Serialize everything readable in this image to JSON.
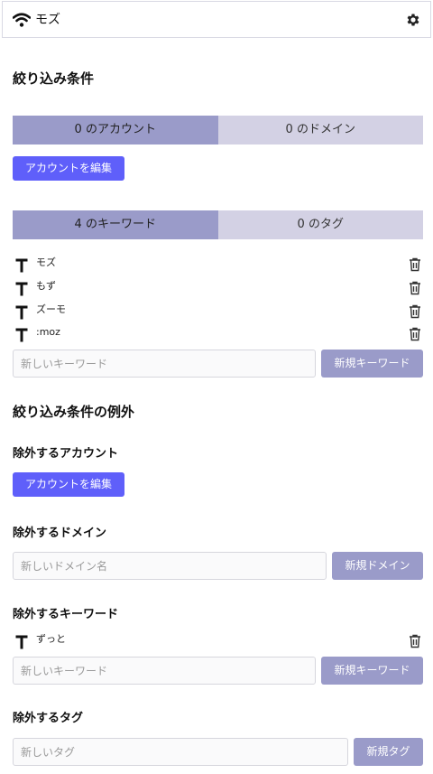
{
  "header": {
    "title": "モズ",
    "icon": "wifi-icon",
    "settings_icon": "gear-icon"
  },
  "filter": {
    "heading": "絞り込み条件",
    "tabs1": [
      "0 のアカウント",
      "0 のドメイン"
    ],
    "edit_accounts": "アカウントを編集",
    "tabs2": [
      "4 のキーワード",
      "0 のタグ"
    ],
    "keywords": [
      "モズ",
      "もず",
      "ズーモ",
      ":moz"
    ],
    "keyword_placeholder": "新しいキーワード",
    "add_keyword": "新規キーワード"
  },
  "exceptions": {
    "heading": "絞り込み条件の例外",
    "accounts_heading": "除外するアカウント",
    "edit_accounts": "アカウントを編集",
    "domains_heading": "除外するドメイン",
    "domain_placeholder": "新しいドメイン名",
    "add_domain": "新規ドメイン",
    "keywords_heading": "除外するキーワード",
    "keywords": [
      "ずっと"
    ],
    "keyword_placeholder": "新しいキーワード",
    "add_keyword": "新規キーワード",
    "tags_heading": "除外するタグ",
    "tag_placeholder": "新しいタグ",
    "add_tag": "新規タグ"
  },
  "colors": {
    "accent": "#5f5ffa",
    "tab_active": "#9a9bc9",
    "tab_inactive": "#d3d1e4"
  }
}
